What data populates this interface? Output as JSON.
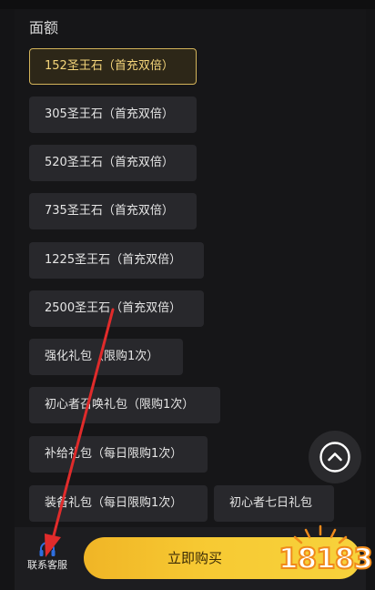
{
  "section": {
    "title": "面额"
  },
  "options": [
    {
      "label": "152圣王石（首充双倍）",
      "selected": true
    },
    {
      "label": "305圣王石（首充双倍）",
      "selected": false
    },
    {
      "label": "520圣王石（首充双倍）",
      "selected": false
    },
    {
      "label": "735圣王石（首充双倍）",
      "selected": false
    },
    {
      "label": "1225圣王石（首充双倍）",
      "selected": false
    },
    {
      "label": "2500圣王石（首充双倍）",
      "selected": false
    },
    {
      "label": "强化礼包（限购1次）",
      "selected": false
    },
    {
      "label": "初心者召唤礼包（限购1次）",
      "selected": false
    },
    {
      "label": "补给礼包（每日限购1次）",
      "selected": false
    },
    {
      "label": "装备礼包（每日限购1次）",
      "selected": false
    },
    {
      "label": "初心者七日礼包",
      "selected": false
    }
  ],
  "scroll_top": {
    "icon": "chevron-up-icon"
  },
  "bottom_bar": {
    "customer_service": {
      "label": "联系客服",
      "icon": "headset-icon"
    },
    "buy": {
      "label": "立即购买"
    }
  },
  "watermark": {
    "text": "18183"
  },
  "colors": {
    "accent": "#d3b35a",
    "buy_button": "#f7ca33",
    "service_icon": "#2f6fe0",
    "arrow": "#e02b2b"
  }
}
